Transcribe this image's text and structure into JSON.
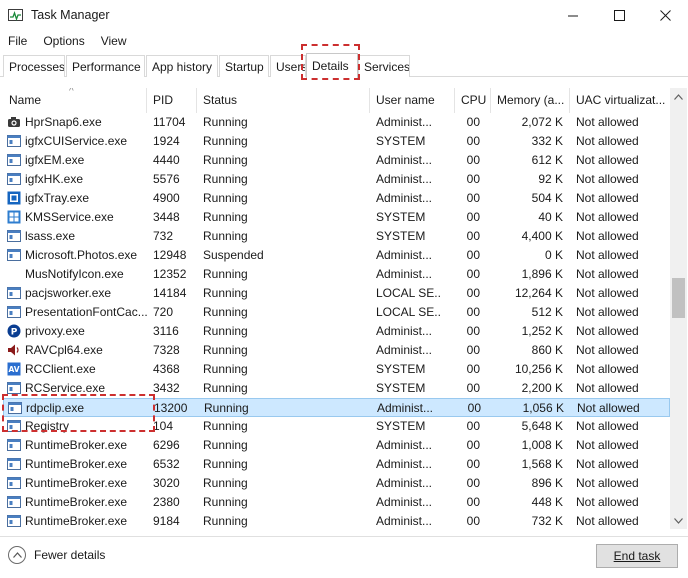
{
  "window": {
    "title": "Task Manager",
    "controls": [
      "minimize",
      "maximize",
      "close"
    ]
  },
  "menu": [
    "File",
    "Options",
    "View"
  ],
  "tabs": [
    {
      "label": "Processes",
      "active": false
    },
    {
      "label": "Performance",
      "active": false
    },
    {
      "label": "App history",
      "active": false
    },
    {
      "label": "Startup",
      "active": false
    },
    {
      "label": "Users",
      "active": false
    },
    {
      "label": "Details",
      "active": true
    },
    {
      "label": "Services",
      "active": false
    }
  ],
  "columns": [
    "Name",
    "PID",
    "Status",
    "User name",
    "CPU",
    "Memory (a...",
    "UAC virtualizat..."
  ],
  "rows": [
    {
      "icon": "camera-icon",
      "name": "HprSnap6.exe",
      "pid": "11704",
      "status": "Running",
      "user": "Administ...",
      "cpu": "00",
      "mem": "2,072 K",
      "uac": "Not allowed"
    },
    {
      "icon": "window-icon",
      "name": "igfxCUIService.exe",
      "pid": "1924",
      "status": "Running",
      "user": "SYSTEM",
      "cpu": "00",
      "mem": "332 K",
      "uac": "Not allowed"
    },
    {
      "icon": "window-icon",
      "name": "igfxEM.exe",
      "pid": "4440",
      "status": "Running",
      "user": "Administ...",
      "cpu": "00",
      "mem": "612 K",
      "uac": "Not allowed"
    },
    {
      "icon": "window-icon",
      "name": "igfxHK.exe",
      "pid": "5576",
      "status": "Running",
      "user": "Administ...",
      "cpu": "00",
      "mem": "92 K",
      "uac": "Not allowed"
    },
    {
      "icon": "intel-tray-icon",
      "name": "igfxTray.exe",
      "pid": "4900",
      "status": "Running",
      "user": "Administ...",
      "cpu": "00",
      "mem": "504 K",
      "uac": "Not allowed"
    },
    {
      "icon": "kms-icon",
      "name": "KMSService.exe",
      "pid": "3448",
      "status": "Running",
      "user": "SYSTEM",
      "cpu": "00",
      "mem": "40 K",
      "uac": "Not allowed"
    },
    {
      "icon": "window-icon",
      "name": "lsass.exe",
      "pid": "732",
      "status": "Running",
      "user": "SYSTEM",
      "cpu": "00",
      "mem": "4,400 K",
      "uac": "Not allowed"
    },
    {
      "icon": "window-icon",
      "name": "Microsoft.Photos.exe",
      "pid": "12948",
      "status": "Suspended",
      "user": "Administ...",
      "cpu": "00",
      "mem": "0 K",
      "uac": "Not allowed"
    },
    {
      "icon": "none",
      "name": "MusNotifyIcon.exe",
      "pid": "12352",
      "status": "Running",
      "user": "Administ...",
      "cpu": "00",
      "mem": "1,896 K",
      "uac": "Not allowed"
    },
    {
      "icon": "window-icon",
      "name": "pacjsworker.exe",
      "pid": "14184",
      "status": "Running",
      "user": "LOCAL SE...",
      "cpu": "00",
      "mem": "12,264 K",
      "uac": "Not allowed"
    },
    {
      "icon": "window-icon",
      "name": "PresentationFontCac...",
      "pid": "720",
      "status": "Running",
      "user": "LOCAL SE...",
      "cpu": "00",
      "mem": "512 K",
      "uac": "Not allowed"
    },
    {
      "icon": "privoxy-icon",
      "name": "privoxy.exe",
      "pid": "3116",
      "status": "Running",
      "user": "Administ...",
      "cpu": "00",
      "mem": "1,252 K",
      "uac": "Not allowed"
    },
    {
      "icon": "speaker-icon",
      "name": "RAVCpl64.exe",
      "pid": "7328",
      "status": "Running",
      "user": "Administ...",
      "cpu": "00",
      "mem": "860 K",
      "uac": "Not allowed"
    },
    {
      "icon": "av-icon",
      "name": "RCClient.exe",
      "pid": "4368",
      "status": "Running",
      "user": "SYSTEM",
      "cpu": "00",
      "mem": "10,256 K",
      "uac": "Not allowed"
    },
    {
      "icon": "window-icon",
      "name": "RCService.exe",
      "pid": "3432",
      "status": "Running",
      "user": "SYSTEM",
      "cpu": "00",
      "mem": "2,200 K",
      "uac": "Not allowed"
    },
    {
      "icon": "window-icon",
      "name": "rdpclip.exe",
      "pid": "13200",
      "status": "Running",
      "user": "Administ...",
      "cpu": "00",
      "mem": "1,056 K",
      "uac": "Not allowed",
      "selected": true
    },
    {
      "icon": "window-icon",
      "name": "Registry",
      "pid": "104",
      "status": "Running",
      "user": "SYSTEM",
      "cpu": "00",
      "mem": "5,648 K",
      "uac": "Not allowed"
    },
    {
      "icon": "window-icon",
      "name": "RuntimeBroker.exe",
      "pid": "6296",
      "status": "Running",
      "user": "Administ...",
      "cpu": "00",
      "mem": "1,008 K",
      "uac": "Not allowed"
    },
    {
      "icon": "window-icon",
      "name": "RuntimeBroker.exe",
      "pid": "6532",
      "status": "Running",
      "user": "Administ...",
      "cpu": "00",
      "mem": "1,568 K",
      "uac": "Not allowed"
    },
    {
      "icon": "window-icon",
      "name": "RuntimeBroker.exe",
      "pid": "3020",
      "status": "Running",
      "user": "Administ...",
      "cpu": "00",
      "mem": "896 K",
      "uac": "Not allowed"
    },
    {
      "icon": "window-icon",
      "name": "RuntimeBroker.exe",
      "pid": "2380",
      "status": "Running",
      "user": "Administ...",
      "cpu": "00",
      "mem": "448 K",
      "uac": "Not allowed"
    },
    {
      "icon": "window-icon",
      "name": "RuntimeBroker.exe",
      "pid": "9184",
      "status": "Running",
      "user": "Administ...",
      "cpu": "00",
      "mem": "732 K",
      "uac": "Not allowed"
    }
  ],
  "footer": {
    "fewer_details": "Fewer details",
    "end_task": "End task"
  },
  "colors": {
    "selection": "#cde8ff",
    "selection_border": "#99c9ef",
    "callout": "#cc2f2f"
  }
}
